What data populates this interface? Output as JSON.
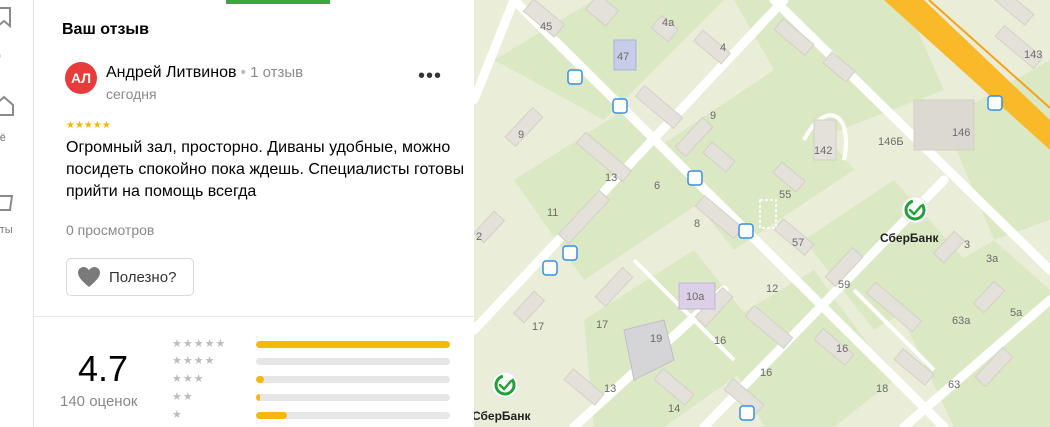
{
  "nav": {
    "items": [
      {
        "label": "д"
      },
      {
        "label": "ьё"
      },
      {
        "label": "еты"
      }
    ]
  },
  "review": {
    "section_title": "Ваш отзыв",
    "avatar_initials": "АЛ",
    "author_name": "Андрей Литвинов",
    "author_reviews": "1 отзыв",
    "date": "сегодня",
    "stars": "★★★★★",
    "text": "Огромный зал, просторно. Диваны удобные, можно посидеть спокойно пока ждешь. Специалисты готовы прийти на помощь всегда",
    "views": "0 просмотров",
    "helpful_label": "Полезно?",
    "more_label": "•••"
  },
  "rating": {
    "score": "4.7",
    "count_label": "140 оценок",
    "distribution": [
      {
        "stars": "★★★★★",
        "fraction": 1.0
      },
      {
        "stars": "★★★★",
        "fraction": 0.0
      },
      {
        "stars": "★★★",
        "fraction": 0.04
      },
      {
        "stars": "★★",
        "fraction": 0.02
      },
      {
        "stars": "★",
        "fraction": 0.16
      }
    ]
  },
  "map": {
    "poi": [
      "СберБанк",
      "СберБанк"
    ],
    "labels": [
      "45",
      "4а",
      "47",
      "4",
      "143",
      "9",
      "146",
      "142",
      "146Б",
      "9",
      "13",
      "6",
      "55",
      "11",
      "8",
      "57",
      "2",
      "3",
      "3а",
      "10а",
      "12",
      "59",
      "17",
      "17",
      "19",
      "16",
      "63а",
      "5а",
      "16",
      "63",
      "13",
      "14",
      "16",
      "18"
    ]
  },
  "colors": {
    "accent_green": "#3ba63b",
    "star_yellow": "#f5b70a",
    "avatar_red": "#e83b3b",
    "road_yellow": "#f9b928"
  }
}
